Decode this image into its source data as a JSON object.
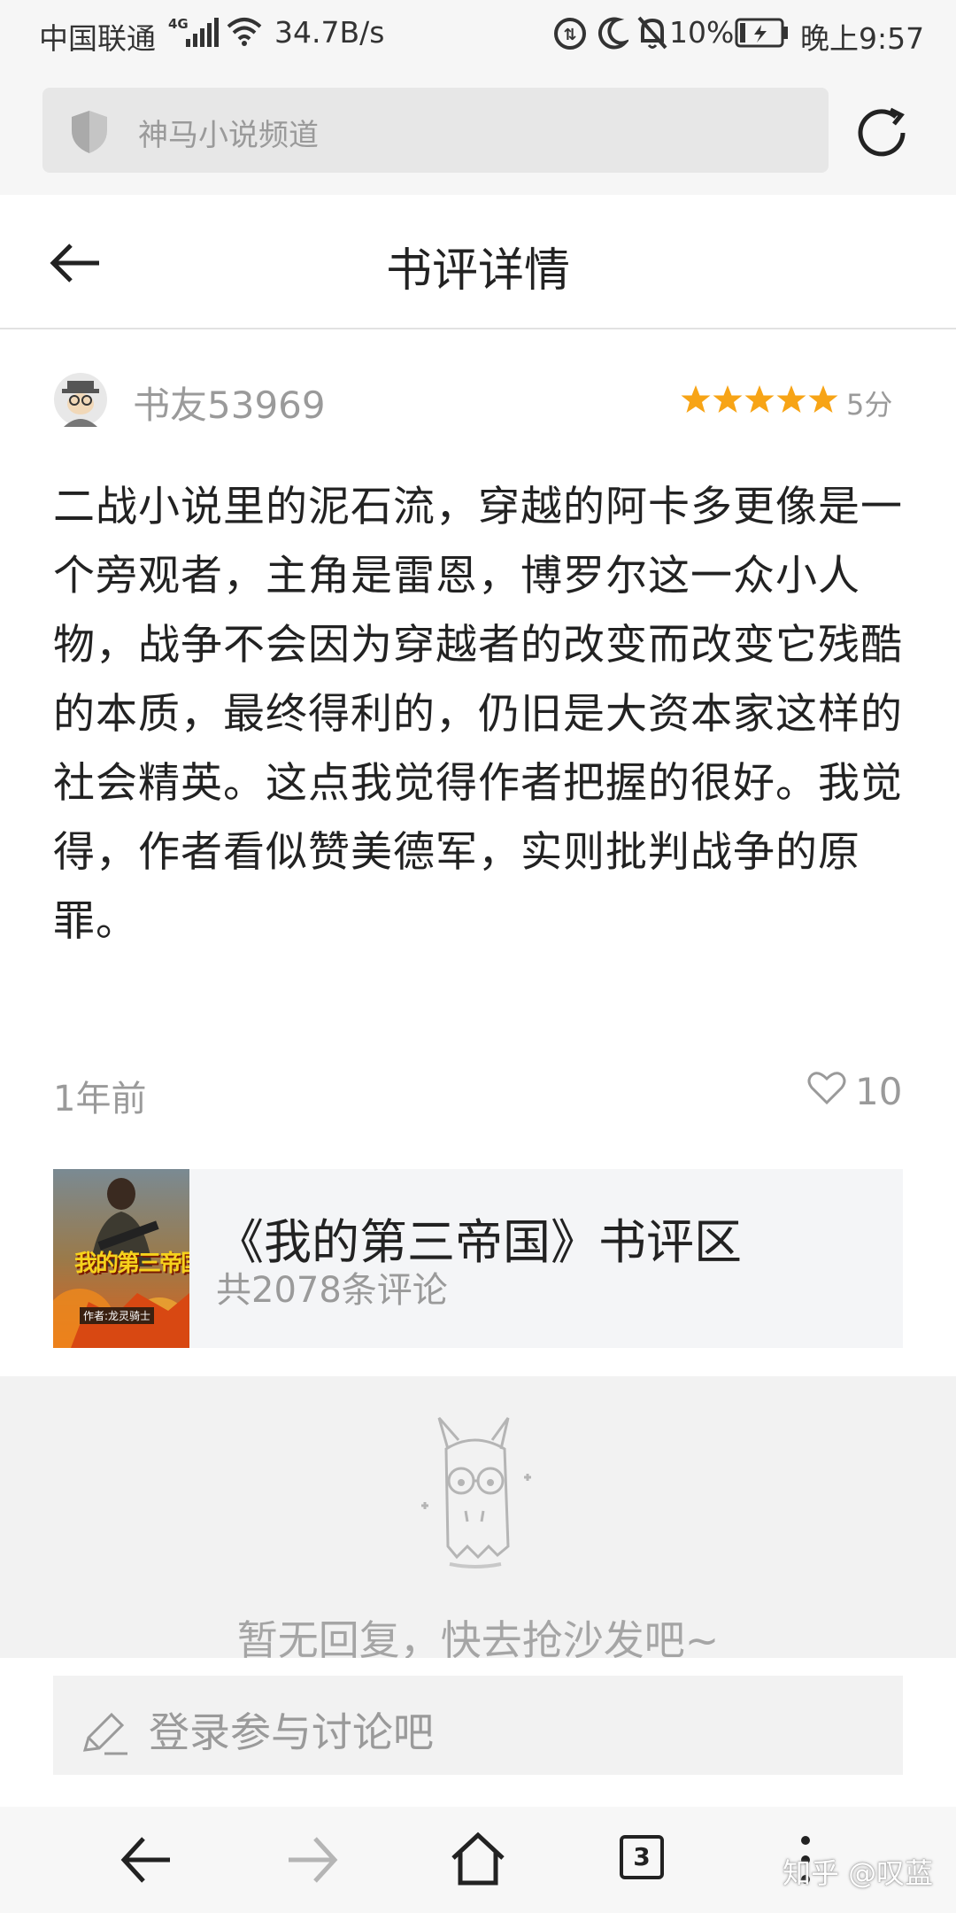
{
  "status_bar": {
    "carrier": "中国联通",
    "network": "4G",
    "speed": "34.7B/s",
    "battery": "10%",
    "time": "晚上9:57"
  },
  "url_bar": {
    "placeholder": "神马小说频道"
  },
  "header": {
    "title": "书评详情"
  },
  "review": {
    "username": "书友53969",
    "score": "5分",
    "rating": 5,
    "text": "二战小说里的泥石流，穿越的阿卡多更像是一个旁观者，主角是雷恩，博罗尔这一众小人物，战争不会因为穿越者的改变而改变它残酷的本质，最终得利的，仍旧是大资本家这样的社会精英。这点我觉得作者把握的很好。我觉得，作者看似赞美德军，实则批判战争的原罪。",
    "time_ago": "1年前",
    "likes": "10"
  },
  "book": {
    "title": "《我的第三帝国》书评区",
    "count": "共2078条评论",
    "cover_title": "我的第三帝国",
    "cover_author": "作者:龙灵骑士"
  },
  "replies": {
    "empty_text": "暂无回复，快去抢沙发吧~"
  },
  "comment": {
    "placeholder": "登录参与讨论吧"
  },
  "bottom_nav": {
    "tab_count": "3",
    "watermark": "知乎 @叹蓝"
  },
  "colors": {
    "star": "#f7a416",
    "gray_text": "#9a9a9a",
    "panel_bg": "#f2f2f2"
  }
}
